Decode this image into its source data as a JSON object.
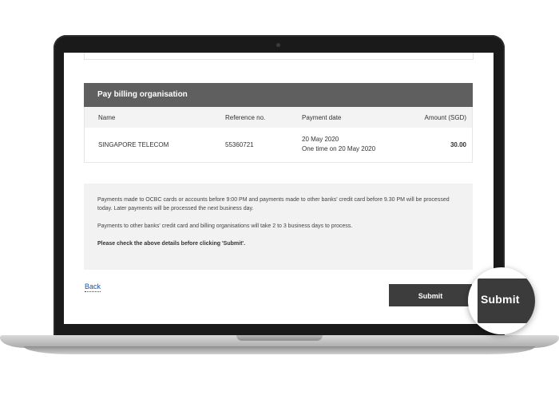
{
  "panel": {
    "title": "Pay billing organisation"
  },
  "table": {
    "headers": {
      "name": "Name",
      "reference": "Reference no.",
      "payment_date": "Payment date",
      "amount": "Amount (SGD)"
    },
    "rows": [
      {
        "name": "SINGAPORE TELECOM",
        "reference": "55360721",
        "payment_date_line1": "20 May 2020",
        "payment_date_line2": "One time on 20 May 2020",
        "amount": "30.00"
      }
    ]
  },
  "info": {
    "paragraph1": "Payments made to OCBC cards or accounts before 9:00 PM and payments made to other banks' credit card before 9.30 PM will be processed today. Later payments will be processed the next business day.",
    "paragraph2": "Payments to other banks' credit card and billing organisations will take 2 to 3 business days to process.",
    "paragraph3": "Please check the above details before clicking 'Submit'."
  },
  "actions": {
    "back_label": "Back",
    "submit_label": "Submit"
  },
  "magnifier": {
    "label": "Submit"
  },
  "colors": {
    "header_bg": "#5f5f5f",
    "button_bg": "#3d3d3d",
    "link": "#1a4fa3",
    "info_bg": "#f2f2f2"
  }
}
